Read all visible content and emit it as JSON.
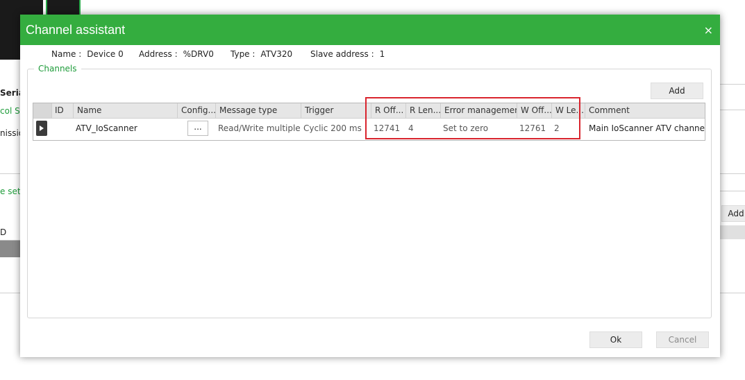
{
  "background": {
    "frag_serial": "Seria",
    "frag_col_se": "col Se",
    "frag_mission": "nissio",
    "frag_e_sett": "e sett",
    "frag_d": "D",
    "add_label": "Add"
  },
  "dialog": {
    "title": "Channel assistant",
    "close_glyph": "×",
    "info": {
      "name_label": "Name :",
      "name_value": "Device 0",
      "address_label": "Address :",
      "address_value": "%DRV0",
      "type_label": "Type :",
      "type_value": "ATV320",
      "slave_label": "Slave address :",
      "slave_value": "1"
    },
    "group_title": "Channels",
    "add_label": "Add",
    "columns": [
      "ID",
      "Name",
      "Config...",
      "Message type",
      "Trigger",
      "R Off...",
      "R Len...",
      "Error management",
      "W Off...",
      "W Le...",
      "Comment"
    ],
    "rows": [
      {
        "id": "",
        "name": "ATV_IoScanner",
        "config": "...",
        "message_type": "Read/Write multiple wo",
        "trigger": "Cyclic 200 ms",
        "r_offset": "12741",
        "r_length": "4",
        "error_management": "Set to zero",
        "w_offset": "12761",
        "w_length": "2",
        "comment": "Main IoScanner ATV channel"
      }
    ],
    "ok_label": "Ok",
    "cancel_label": "Cancel"
  }
}
